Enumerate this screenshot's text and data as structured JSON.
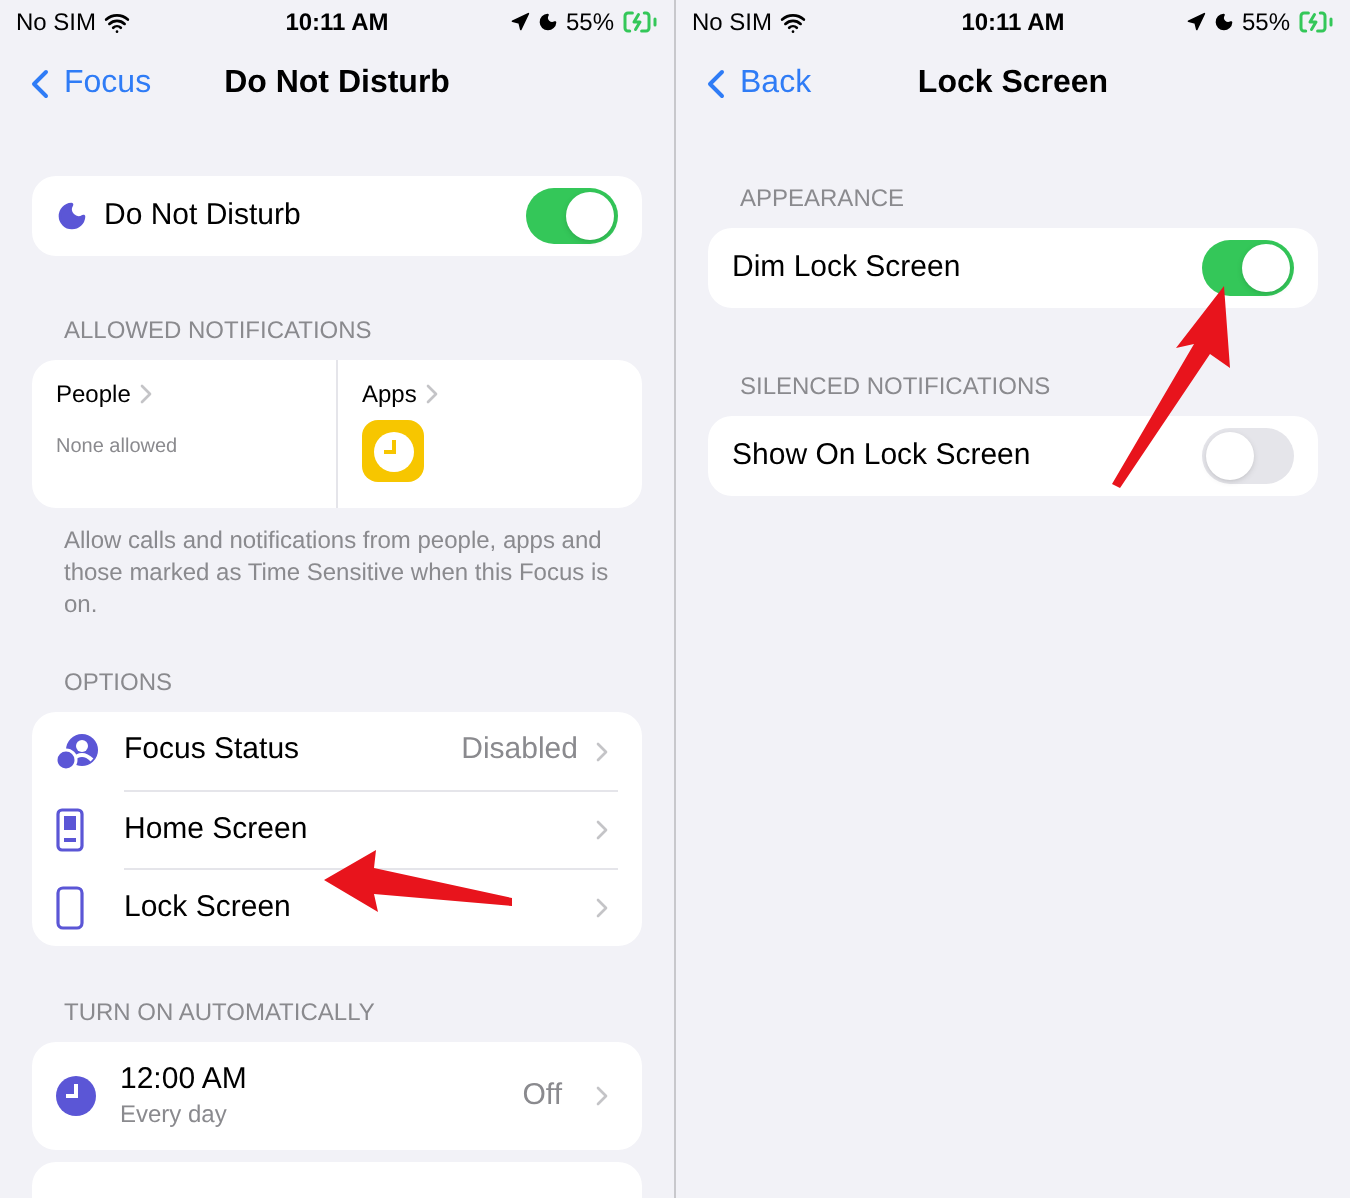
{
  "left": {
    "status_bar": {
      "carrier": "No SIM",
      "time": "10:11 AM",
      "battery": "55%"
    },
    "nav": {
      "back": "Focus",
      "title": "Do Not Disturb"
    },
    "focus_toggle": {
      "label": "Do Not Disturb",
      "on": true
    },
    "allowed": {
      "header": "ALLOWED NOTIFICATIONS",
      "people": {
        "label": "People",
        "value": "None allowed"
      },
      "apps": {
        "label": "Apps"
      },
      "footer": "Allow calls and notifications from people, apps and those marked as Time Sensitive when this Focus is on."
    },
    "options": {
      "header": "OPTIONS",
      "items": [
        {
          "kind": "focus-status",
          "label": "Focus Status",
          "value": "Disabled"
        },
        {
          "kind": "home",
          "label": "Home Screen"
        },
        {
          "kind": "lock",
          "label": "Lock Screen"
        }
      ]
    },
    "automation": {
      "header": "TURN ON AUTOMATICALLY",
      "items": [
        {
          "time": "12:00 AM",
          "repeat": "Every day",
          "value": "Off"
        }
      ]
    }
  },
  "right": {
    "status_bar": {
      "carrier": "No SIM",
      "time": "10:11 AM",
      "battery": "55%"
    },
    "nav": {
      "back": "Back",
      "title": "Lock Screen"
    },
    "sections": [
      {
        "header": "APPEARANCE",
        "rows": [
          {
            "label": "Dim Lock Screen",
            "on": true
          }
        ]
      },
      {
        "header": "SILENCED NOTIFICATIONS",
        "rows": [
          {
            "label": "Show On Lock Screen",
            "on": false
          }
        ]
      }
    ]
  }
}
